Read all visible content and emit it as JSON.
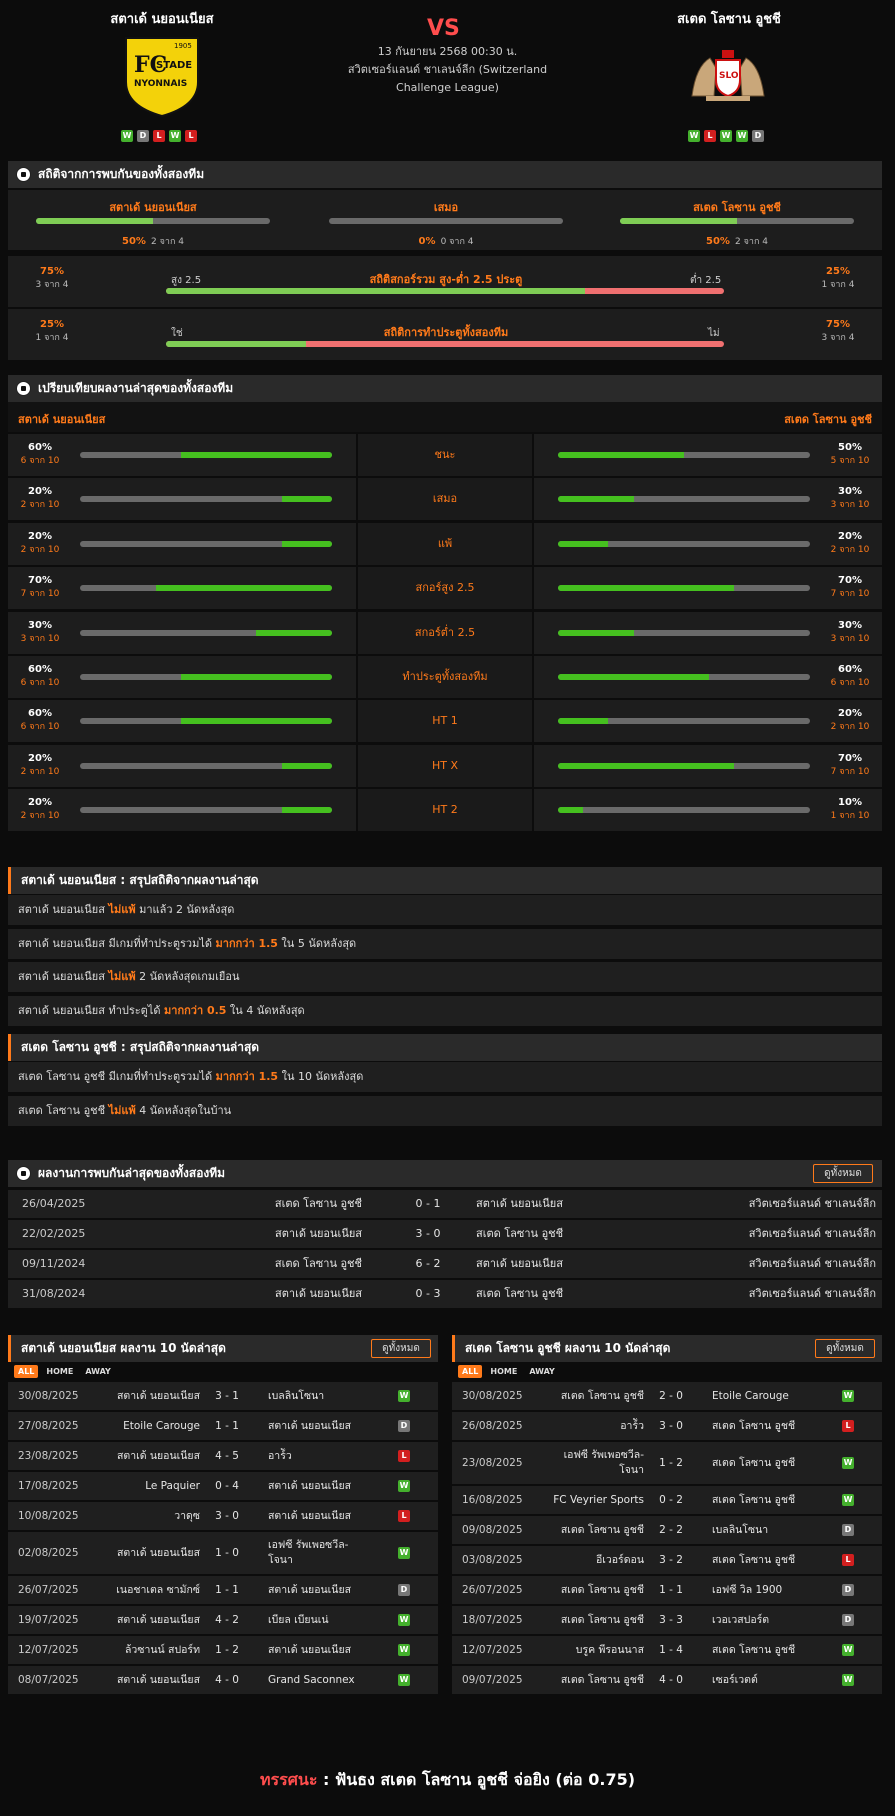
{
  "header": {
    "home_team": "สตาเด้ นยอนเนียส",
    "away_team": "สเตด โลซาน อูชชี",
    "vs": "VS",
    "datetime": "13 กันยายน 2568 00:30 น.",
    "league": "สวิตเซอร์แลนด์ ชาเลนจ์ลีก (Switzerland Challenge League)",
    "home_form": [
      "W",
      "D",
      "L",
      "W",
      "L"
    ],
    "away_form": [
      "W",
      "L",
      "W",
      "W",
      "D"
    ],
    "home_logo_text": [
      "1905",
      "FC",
      "STADE",
      "NYONNAIS"
    ],
    "away_logo_text": "SLO"
  },
  "h2h_stats": {
    "title": "สถิติจากการพบกันของทั้งสองทีม",
    "items": [
      {
        "label": "สตาเด้ นยอนเนียส",
        "pct": "50%",
        "count": "2 จาก 4",
        "fill": 0.5
      },
      {
        "label": "เสมอ",
        "pct": "0%",
        "count": "0 จาก 4",
        "fill": 0
      },
      {
        "label": "สเตด โลซาน อูชชี",
        "pct": "50%",
        "count": "2 จาก 4",
        "fill": 0.5
      }
    ],
    "ou": {
      "title": "สถิติสกอร์รวม สูง-ต่ำ 2.5 ประตู",
      "left_pct": "75%",
      "left_count": "3 จาก 4",
      "left_label": "สูง 2.5",
      "right_label": "ต่ำ 2.5",
      "right_pct": "25%",
      "right_count": "1 จาก 4",
      "fill": 0.75
    },
    "btts": {
      "title": "สถิติการทำประตูทั้งสองทีม",
      "left_pct": "25%",
      "left_count": "1 จาก 4",
      "left_label": "ใช่",
      "right_label": "ไม่",
      "right_pct": "75%",
      "right_count": "3 จาก 4",
      "fill": 0.25
    }
  },
  "compare": {
    "title": "เปรียบเทียบผลงานล่าสุดของทั้งสองทีม",
    "home": "สตาเด้ นยอนเนียส",
    "away": "สเตด โลซาน อูชชี",
    "rows": [
      {
        "label": "ชนะ",
        "hp": "60%",
        "hc": "6 จาก 10",
        "hf": 0.6,
        "ap": "50%",
        "ac": "5 จาก 10",
        "af": 0.5
      },
      {
        "label": "เสมอ",
        "hp": "20%",
        "hc": "2 จาก 10",
        "hf": 0.2,
        "ap": "30%",
        "ac": "3 จาก 10",
        "af": 0.3
      },
      {
        "label": "แพ้",
        "hp": "20%",
        "hc": "2 จาก 10",
        "hf": 0.2,
        "ap": "20%",
        "ac": "2 จาก 10",
        "af": 0.2
      },
      {
        "label": "สกอร์สูง 2.5",
        "hp": "70%",
        "hc": "7 จาก 10",
        "hf": 0.7,
        "ap": "70%",
        "ac": "7 จาก 10",
        "af": 0.7
      },
      {
        "label": "สกอร์ต่ำ 2.5",
        "hp": "30%",
        "hc": "3 จาก 10",
        "hf": 0.3,
        "ap": "30%",
        "ac": "3 จาก 10",
        "af": 0.3
      },
      {
        "label": "ทำประตูทั้งสองทีม",
        "hp": "60%",
        "hc": "6 จาก 10",
        "hf": 0.6,
        "ap": "60%",
        "ac": "6 จาก 10",
        "af": 0.6
      },
      {
        "label": "HT 1",
        "hp": "60%",
        "hc": "6 จาก 10",
        "hf": 0.6,
        "ap": "20%",
        "ac": "2 จาก 10",
        "af": 0.2
      },
      {
        "label": "HT X",
        "hp": "20%",
        "hc": "2 จาก 10",
        "hf": 0.2,
        "ap": "70%",
        "ac": "7 จาก 10",
        "af": 0.7
      },
      {
        "label": "HT 2",
        "hp": "20%",
        "hc": "2 จาก 10",
        "hf": 0.2,
        "ap": "10%",
        "ac": "1 จาก 10",
        "af": 0.1
      }
    ]
  },
  "home_summary": {
    "title": "สตาเด้ นยอนเนียส : สรุปสถิติจากผลงานล่าสุด",
    "lines": [
      {
        "a": "สตาเด้ นยอนเนียส ",
        "h": "ไม่แพ้",
        "b": " มาแล้ว 2 นัดหลังสุด"
      },
      {
        "a": "สตาเด้ นยอนเนียส  มีเกมที่ทำประตูรวมได้ ",
        "h": "มากกว่า 1.5",
        "b": " ใน 5 นัดหลังสุด"
      },
      {
        "a": "สตาเด้ นยอนเนียส ",
        "h": "ไม่แพ้",
        "b": " 2 นัดหลังสุดเกมเยือน"
      },
      {
        "a": "สตาเด้ นยอนเนียส  ทำประตูได้ ",
        "h": "มากกว่า 0.5",
        "b": " ใน 4 นัดหลังสุด"
      }
    ]
  },
  "away_summary": {
    "title": "สเตด โลซาน อูชชี : สรุปสถิติจากผลงานล่าสุด",
    "lines": [
      {
        "a": "สเตด โลซาน อูชชี  มีเกมที่ทำประตูรวมได้ ",
        "h": "มากกว่า 1.5",
        "b": " ใน 10 นัดหลังสุด"
      },
      {
        "a": "สเตด โลซาน อูชชี ",
        "h": "ไม่แพ้",
        "b": " 4 นัดหลังสุดในบ้าน"
      }
    ]
  },
  "h2h": {
    "title": "ผลงานการพบกันล่าสุดของทั้งสองทีม",
    "button": "ดูทั้งหมด",
    "rows": [
      {
        "date": "26/04/2025",
        "home": "สเตด โลซาน อูชชี",
        "score": "0 - 1",
        "away": "สตาเด้ นยอนเนียส",
        "league": "สวิตเซอร์แลนด์ ชาเลนจ์ลีก"
      },
      {
        "date": "22/02/2025",
        "home": "สตาเด้ นยอนเนียส",
        "score": "3 - 0",
        "away": "สเตด โลซาน อูชชี",
        "league": "สวิตเซอร์แลนด์ ชาเลนจ์ลีก"
      },
      {
        "date": "09/11/2024",
        "home": "สเตด โลซาน อูชชี",
        "score": "6 - 2",
        "away": "สตาเด้ นยอนเนียส",
        "league": "สวิตเซอร์แลนด์ ชาเลนจ์ลีก"
      },
      {
        "date": "31/08/2024",
        "home": "สตาเด้ นยอนเนียส",
        "score": "0 - 3",
        "away": "สเตด โลซาน อูชชี",
        "league": "สวิตเซอร์แลนด์ ชาเลนจ์ลีก"
      }
    ]
  },
  "home_recent": {
    "title": "สตาเด้ นยอนเนียส ผลงาน 10 นัดล่าสุด",
    "button": "ดูทั้งหมด",
    "tabs": [
      "ALL",
      "HOME",
      "AWAY"
    ],
    "rows": [
      {
        "date": "30/08/2025",
        "home": "สตาเด้ นยอนเนียส",
        "score": "3 - 1",
        "away": "เบลลินโซนา",
        "r": "W"
      },
      {
        "date": "27/08/2025",
        "home": "Etoile Carouge",
        "score": "1 - 1",
        "away": "สตาเด้ นยอนเนียส",
        "r": "D"
      },
      {
        "date": "23/08/2025",
        "home": "สตาเด้ นยอนเนียส",
        "score": "4 - 5",
        "away": "อาร์ัว",
        "r": "L"
      },
      {
        "date": "17/08/2025",
        "home": "Le Paquier",
        "score": "0 - 4",
        "away": "สตาเด้ นยอนเนียส",
        "r": "W"
      },
      {
        "date": "10/08/2025",
        "home": "วาดุซ",
        "score": "3 - 0",
        "away": "สตาเด้ นยอนเนียส",
        "r": "L"
      },
      {
        "date": "02/08/2025",
        "home": "สตาเด้ นยอนเนียส",
        "score": "1 - 0",
        "away": "เอฟซี รัพเพอซวีล-โจนา",
        "r": "W"
      },
      {
        "date": "26/07/2025",
        "home": "เนอชาเตล ซามักซ์",
        "score": "1 - 1",
        "away": "สตาเด้ นยอนเนียส",
        "r": "D"
      },
      {
        "date": "19/07/2025",
        "home": "สตาเด้ นยอนเนียส",
        "score": "4 - 2",
        "away": "เบียล เบียนเน่",
        "r": "W"
      },
      {
        "date": "12/07/2025",
        "home": "ล้วซานน์ สปอร์ท",
        "score": "1 - 2",
        "away": "สตาเด้ นยอนเนียส",
        "r": "W"
      },
      {
        "date": "08/07/2025",
        "home": "สตาเด้ นยอนเนียส",
        "score": "4 - 0",
        "away": "Grand Saconnex",
        "r": "W"
      }
    ]
  },
  "away_recent": {
    "title": "สเตด โลซาน อูชชี ผลงาน 10 นัดล่าสุด",
    "button": "ดูทั้งหมด",
    "tabs": [
      "ALL",
      "HOME",
      "AWAY"
    ],
    "rows": [
      {
        "date": "30/08/2025",
        "home": "สเตด โลซาน อูชชี",
        "score": "2 - 0",
        "away": "Etoile Carouge",
        "r": "W"
      },
      {
        "date": "26/08/2025",
        "home": "อาร์ัว",
        "score": "3 - 0",
        "away": "สเตด โลซาน อูชชี",
        "r": "L"
      },
      {
        "date": "23/08/2025",
        "home": "เอฟซี รัพเพอซวีล-โจนา",
        "score": "1 - 2",
        "away": "สเตด โลซาน อูชชี",
        "r": "W"
      },
      {
        "date": "16/08/2025",
        "home": "FC Veyrier Sports",
        "score": "0 - 2",
        "away": "สเตด โลซาน อูชชี",
        "r": "W"
      },
      {
        "date": "09/08/2025",
        "home": "สเตด โลซาน อูชชี",
        "score": "2 - 2",
        "away": "เบลลินโซนา",
        "r": "D"
      },
      {
        "date": "03/08/2025",
        "home": "อีเวอร์ดอน",
        "score": "3 - 2",
        "away": "สเตด โลซาน อูชชี",
        "r": "L"
      },
      {
        "date": "26/07/2025",
        "home": "สเตด โลซาน อูชชี",
        "score": "1 - 1",
        "away": "เอฟซี วิล 1900",
        "r": "D"
      },
      {
        "date": "18/07/2025",
        "home": "สเตด โลซาน อูชชี",
        "score": "3 - 3",
        "away": "เวอเวสปอร์ต",
        "r": "D"
      },
      {
        "date": "12/07/2025",
        "home": "บรูค พีรอนนาส",
        "score": "1 - 4",
        "away": "สเตด โลซาน อูชชี",
        "r": "W"
      },
      {
        "date": "09/07/2025",
        "home": "สเตด โลซาน อูชชี",
        "score": "4 - 0",
        "away": "เซอร์เวตต์",
        "r": "W"
      }
    ]
  },
  "verdict": {
    "label": "ทรรศนะ",
    "sep": " :  ",
    "text": "ฟันธง สเตด โลซาน อูชชี จ่อยิง (ต่อ 0.75)"
  },
  "colors": {
    "accent": "#ff7a1a",
    "win": "#44b02d",
    "draw": "#777777",
    "loss": "#d21f1f",
    "bar_green": "#45c01f",
    "bar_red": "#f07070"
  }
}
